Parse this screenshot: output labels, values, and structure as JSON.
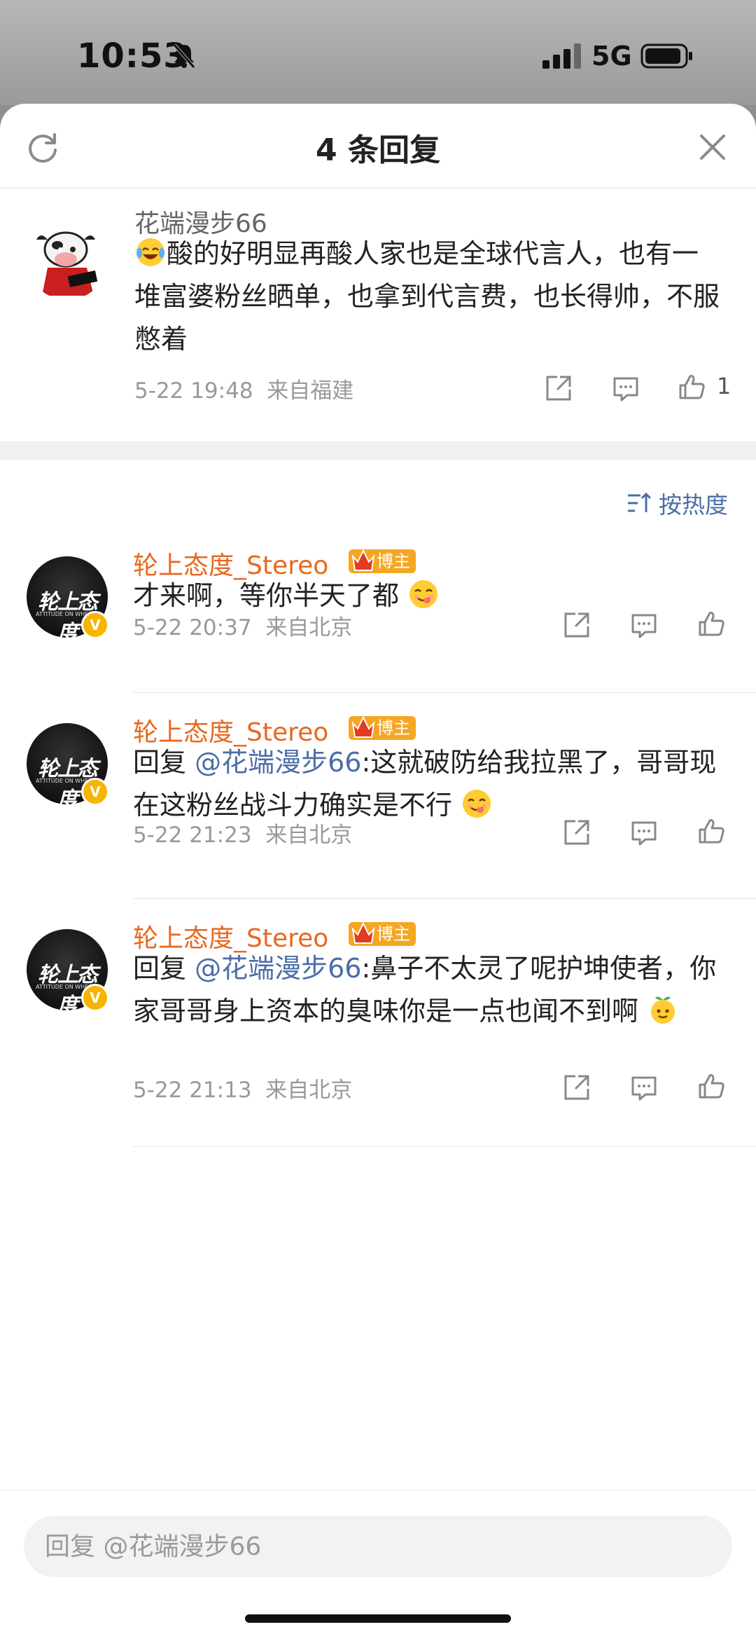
{
  "status_bar": {
    "time": "10:53",
    "network": "5G"
  },
  "header": {
    "title": "4 条回复"
  },
  "root_comment": {
    "username": "花端漫步66",
    "text": "酸的好明显再酸人家也是全球代言人，也有一堆富婆粉丝晒单，也拿到代言费，也长得帅，不服憋着",
    "time": "5-22 19:48",
    "location": "来自福建",
    "like_count": "1"
  },
  "sort": {
    "label": "按热度"
  },
  "replies": [
    {
      "username": "轮上态度_Stereo",
      "badge": "博主",
      "prefix": "",
      "mention": "",
      "text": "才来啊，等你半天了都",
      "time": "5-22 20:37",
      "location": "来自北京"
    },
    {
      "username": "轮上态度_Stereo",
      "badge": "博主",
      "prefix": "回复 ",
      "mention": "@花端漫步66",
      "text": ":这就破防给我拉黑了，哥哥现在这粉丝战斗力确实是不行",
      "time": "5-22 21:23",
      "location": "来自北京"
    },
    {
      "username": "轮上态度_Stereo",
      "badge": "博主",
      "prefix": "回复 ",
      "mention": "@花端漫步66",
      "text": ":鼻子不太灵了呢护坤使者，你家哥哥身上资本的臭味你是一点也闻不到啊",
      "time": "5-22 21:13",
      "location": "来自北京"
    }
  ],
  "avatar_logo_text": "轮上态度",
  "avatar_logo_sub": "ATTITUDE ON WHEELS",
  "reply_box": {
    "placeholder": "回复 @花端漫步66"
  },
  "colors": {
    "accent_orange": "#e8681f",
    "link_blue": "#4b6ea8",
    "badge_gold": "#f5a623"
  }
}
